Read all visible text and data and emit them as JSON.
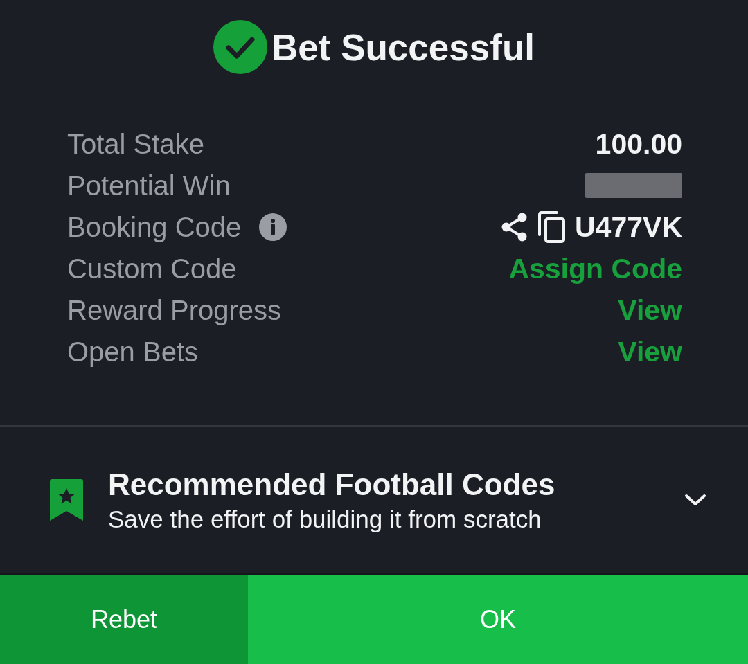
{
  "header": {
    "title": "Bet Successful"
  },
  "summary": [
    {
      "label": "Total Stake",
      "kind": "amount",
      "value": "100.00",
      "info": false
    },
    {
      "label": "Potential Win",
      "kind": "redacted",
      "info": false
    },
    {
      "label": "Booking Code",
      "kind": "code",
      "value": "U477VK",
      "info": true
    },
    {
      "label": "Custom Code",
      "kind": "link",
      "value": "Assign Code",
      "info": false
    },
    {
      "label": "Reward Progress",
      "kind": "link",
      "value": "View",
      "info": false
    },
    {
      "label": "Open Bets",
      "kind": "link",
      "value": "View",
      "info": false
    }
  ],
  "recommendation": {
    "title": "Recommended Football Codes",
    "subtitle": "Save the effort of building it from scratch",
    "expanded": false
  },
  "buttons": [
    {
      "label": "Rebet",
      "kind": "secondary"
    },
    {
      "label": "OK",
      "kind": "primary"
    }
  ]
}
